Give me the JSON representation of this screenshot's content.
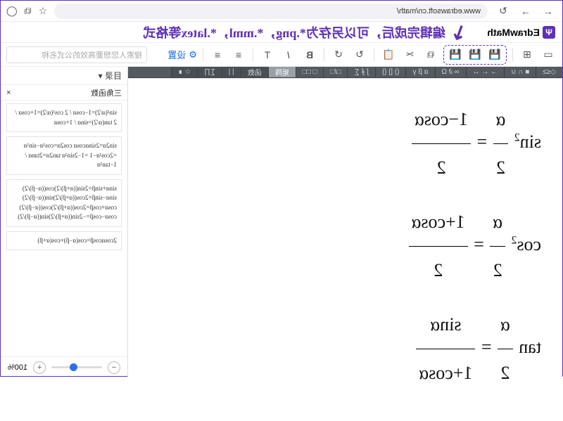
{
  "browser": {
    "url": "www.edrawsoft.cn/math/",
    "nav": {
      "back": "←",
      "forward": "→",
      "reload": "↻"
    },
    "right": {
      "star": "☆",
      "ext": "⧉",
      "user": "◯"
    }
  },
  "logo": {
    "glyph": "Ψ",
    "text": "EdrawMath"
  },
  "annotation": {
    "arrow": "↘",
    "text": "编辑完成后，可以另存为*.png，*.mml，*.latex等格式"
  },
  "toolbar": {
    "folder": "▭",
    "plus": "⊞",
    "save1": "💾",
    "save2": "💾",
    "save3": "💾",
    "copy": "⧉",
    "cut": "✂",
    "paste": "📋",
    "redo": "↻",
    "undo": "↺",
    "bold": "B",
    "italic": "I",
    "text": "T",
    "alignL": "≡",
    "alignC": "≡",
    "gear": "⚙",
    "settings_label": "设置",
    "search_ph": "搜索人您想要高效的公式名称"
  },
  "sym_tabs": [
    "◇≤≥",
    "■ ∩ ∪",
    "→ ← ↔",
    "∞ ∂ Ω",
    "α β γ",
    "() [] {}",
    "∫ ∮ ∑",
    "□/□",
    "□ □□",
    "矩阵",
    "函数",
    "| |",
    "∑∏",
    "☆ ∎"
  ],
  "active_tab_index": 9,
  "sym_grid": [
    "□",
    "▭",
    "▯",
    "▢",
    "⬚",
    "⊞",
    "⊟",
    "⊡",
    "⊠",
    "⌷",
    "⌸",
    "⌹",
    "⌺",
    "⌻",
    "⎕",
    "⎔",
    "⌗",
    "⌘",
    "⌦",
    "⌫",
    "⌧",
    "⊕",
    "⊖",
    "⊗",
    "⊘",
    "⊙",
    "⊚",
    "⊛",
    "⌶",
    "⌇",
    "⌆",
    "⌅",
    "⌄",
    "⌃",
    "⌂",
    "⌁",
    "⌀",
    "⋮",
    "⋯",
    "⋰",
    "⋱",
    "⁞",
    "⁝",
    "∴",
    "∵",
    "∶",
    "∷",
    "⦀",
    "‖",
    "|",
    "¦",
    "╎",
    "╏",
    "┊",
    "┋",
    "┆"
  ],
  "mini_grid": [
    "☐",
    "⊡",
    "△",
    "▽",
    "○",
    "◇",
    "□",
    "◻",
    "◼",
    "◦",
    "•",
    "▪"
  ],
  "equations": {
    "e1": {
      "lnum": "α",
      "lden": "2",
      "lhs_pre": "sin",
      "lhs_sup": "2",
      "rnum": "1−cosα",
      "rden": "2"
    },
    "e2": {
      "lnum": "α",
      "lden": "2",
      "lhs_pre": "cos",
      "lhs_sup": "2",
      "rnum": "1+cosα",
      "rden": "2"
    },
    "e3": {
      "lnum": "α",
      "lden": "2",
      "lhs_pre": "tan",
      "lhs_sup": "",
      "rnum": "sinα",
      "rden": "1+cosα"
    }
  },
  "sidebar": {
    "head": "目录 ▾",
    "sub": "三角函数",
    "close": "×",
    "cards": [
      "sin²(α/2)=1−cosα / 2\ncos²(α/2)=1+cosα / 2\ntan(α/2)=sinα / 1+cosα",
      "sin2α=2sinαcosα\ncos2α=cos²α−sin²α\n    =2cos²α−1\n    =1−2sin²α\ntan2α=2tanα / 1−tan²α",
      "sinα+sinβ=2sin((α+β)/2)cos((α−β)/2)\nsinα−sinβ=2cos((α+β)/2)sin((α−β)/2)\ncosα+cosβ=2cos((α+β)/2)cos((α−β)/2)\ncosα−cosβ=−2sin((α+β)/2)sin((α−β)/2)",
      "2cosαcosβ=cos(α−β)+cos(α+β)"
    ]
  },
  "zoom": {
    "minus": "−",
    "plus": "+",
    "pct": "100%"
  }
}
